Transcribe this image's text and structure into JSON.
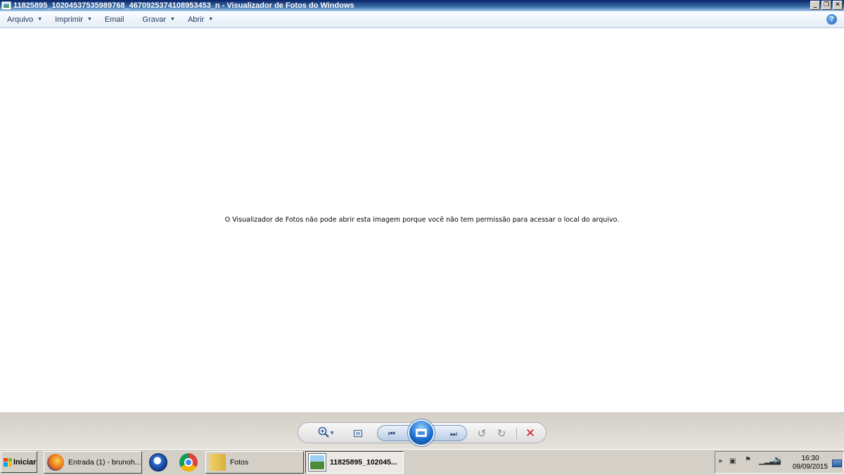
{
  "window": {
    "title": "11825895_10204537535989768_4670925374108953453_n - Visualizador de Fotos do Windows",
    "buttons": {
      "minimize": "_",
      "maximize": "❐",
      "close": "✕"
    }
  },
  "menu": {
    "items": [
      {
        "label": "Arquivo",
        "has_dropdown": true
      },
      {
        "label": "Imprimir",
        "has_dropdown": true
      },
      {
        "label": "Email",
        "has_dropdown": false
      },
      {
        "label": "Gravar",
        "has_dropdown": true
      },
      {
        "label": "Abrir",
        "has_dropdown": true
      }
    ],
    "help_glyph": "?"
  },
  "content": {
    "message": "O Visualizador de Fotos não pode abrir esta imagem porque você não tem permissão para acessar o local do arquivo."
  },
  "controls": {
    "zoom_icon": "magnifier-plus",
    "prev_glyph": "⏮",
    "next_glyph": "⏭",
    "rotate_left_glyph": "↺",
    "rotate_right_glyph": "↻",
    "delete_glyph": "✕"
  },
  "taskbar": {
    "start_label": "Iniciar",
    "tasks": [
      {
        "label": "Entrada (1) - brunoh...",
        "icon": "firefox-icon"
      },
      {
        "label": "Fotos",
        "icon": "folder-icon"
      },
      {
        "label": "11825895_102045...",
        "icon": "photo-viewer-icon",
        "active": true
      }
    ],
    "quick_launch": [
      "thunderbird-icon",
      "chrome-icon"
    ],
    "tray": {
      "time": "16:30",
      "date": "09/09/2015",
      "up_glyph": "»",
      "device_glyph": "▣",
      "flag_glyph": "⚑",
      "signal_glyph": "▁▂▃▅",
      "volume_glyph": "🔊"
    }
  }
}
